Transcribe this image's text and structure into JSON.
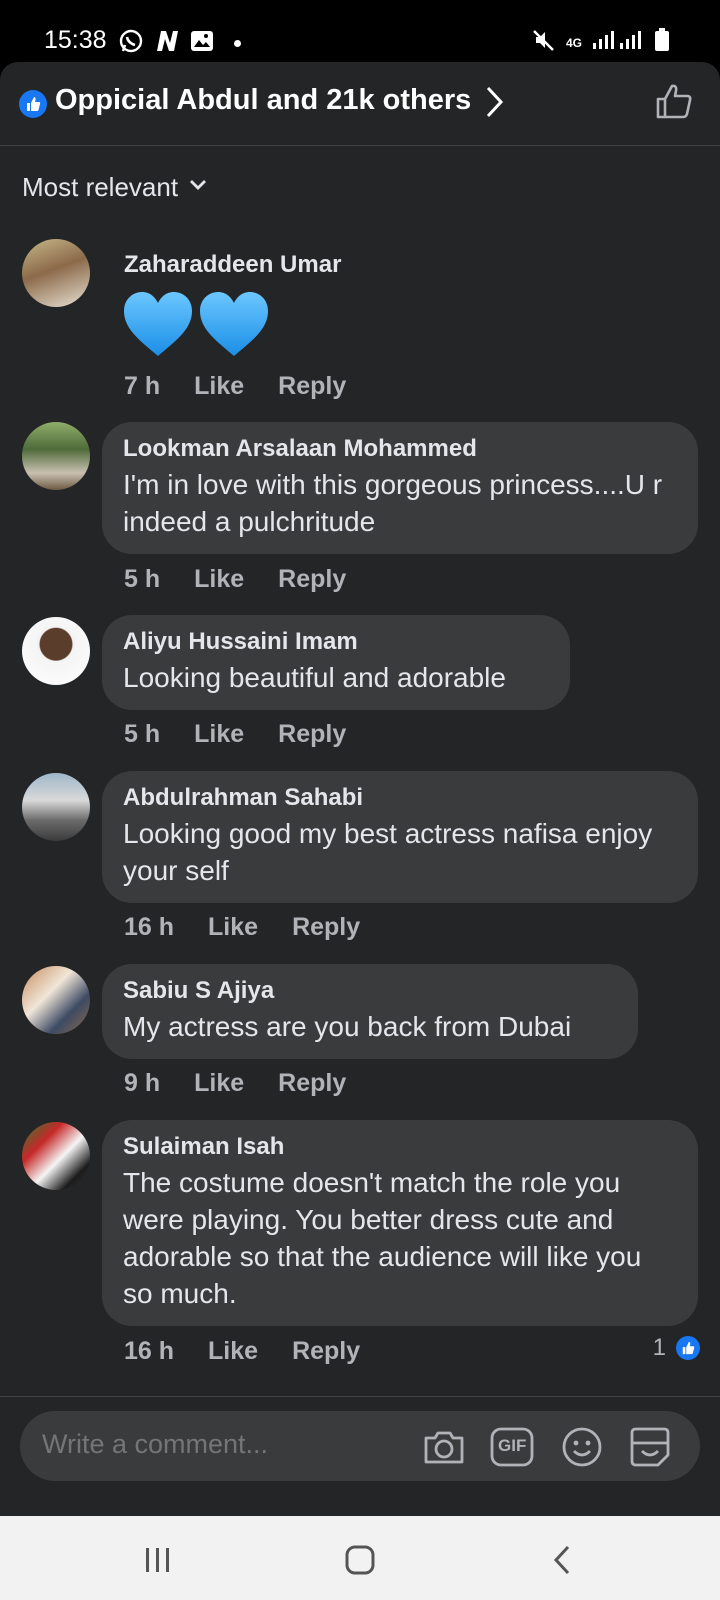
{
  "status_bar": {
    "time": "15:38",
    "network": "4G"
  },
  "header": {
    "reactions_text": "Oppicial Abdul and 21k others"
  },
  "sort": {
    "label": "Most relevant"
  },
  "comments": [
    {
      "name": "Zaharaddeen Umar",
      "text": "",
      "time": "7 h",
      "like": "Like",
      "reply": "Reply"
    },
    {
      "name": "Lookman Arsalaan Mohammed",
      "text": "I'm in love with this gorgeous princess....U r indeed a pulchritude",
      "time": "5 h",
      "like": "Like",
      "reply": "Reply"
    },
    {
      "name": "Aliyu Hussaini Imam",
      "text": "Looking beautiful and adorable",
      "time": "5 h",
      "like": "Like",
      "reply": "Reply"
    },
    {
      "name": "Abdulrahman Sahabi",
      "text": "Looking good my best actress nafisa enjoy your self",
      "time": "16 h",
      "like": "Like",
      "reply": "Reply"
    },
    {
      "name": "Sabiu S Ajiya",
      "text": "My actress are you back from Dubai",
      "time": "9 h",
      "like": "Like",
      "reply": "Reply"
    },
    {
      "name": "Sulaiman Isah",
      "text": "The costume doesn't match the role you were playing. You better dress cute and adorable so that the audience will like you so much.",
      "time": "16 h",
      "like": "Like",
      "reply": "Reply",
      "reaction_count": "1"
    }
  ],
  "composer": {
    "placeholder": "Write a comment...",
    "gif_label": "GIF"
  },
  "colors": {
    "background": "#242526",
    "bubble": "#3a3b3c",
    "accent": "#1877f2",
    "heart": "#29a3f5"
  },
  "icons": [
    "whatsapp-icon",
    "n-icon",
    "gallery-icon",
    "mute-icon",
    "signal-icon",
    "battery-icon",
    "like-badge-icon",
    "chevron-right-icon",
    "thumbs-up-icon",
    "chevron-down-icon",
    "blue-heart-icon",
    "camera-icon",
    "gif-icon",
    "emoji-icon",
    "sticker-icon",
    "recents-icon",
    "home-icon",
    "back-icon"
  ]
}
